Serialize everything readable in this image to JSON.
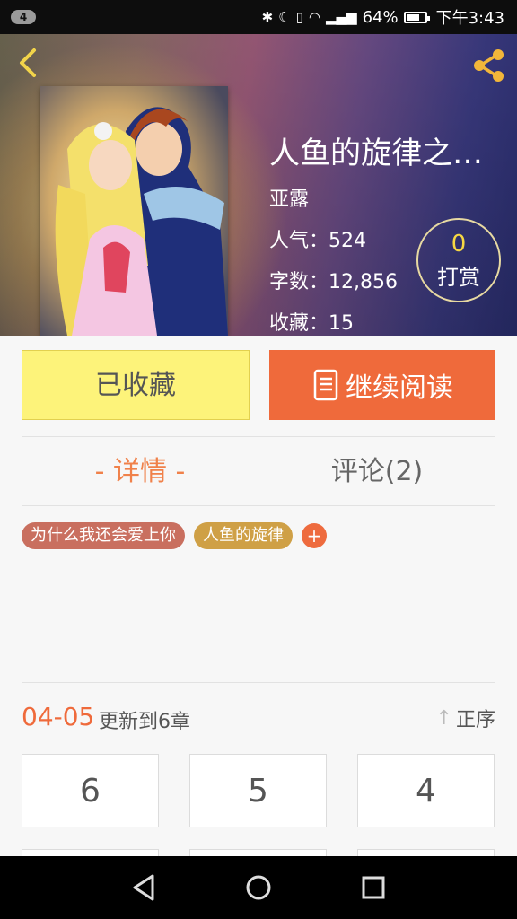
{
  "status_bar": {
    "notification_count": "4",
    "battery": "64%",
    "time": "下午3:43",
    "icons": [
      "bluetooth-icon",
      "moon-icon",
      "vibrate-icon",
      "wifi-icon",
      "signal-icon",
      "battery-icon"
    ]
  },
  "header": {
    "title": "人鱼的旋律之…",
    "author": "亚露",
    "popularity_label": "人气：",
    "popularity": "524",
    "word_count_label": "字数：",
    "word_count": "12,856",
    "favorites_label": "收藏：",
    "favorites": "15",
    "reward_count": "0",
    "reward_label": "打赏"
  },
  "actions": {
    "collected_label": "已收藏",
    "continue_label": "继续阅读"
  },
  "tabs": {
    "detail": "- 详情 -",
    "comments": "评论(2)"
  },
  "tags": [
    "为什么我还会爱上你",
    "人鱼的旋律",
    "+"
  ],
  "updates": {
    "date": "04-05",
    "text": "更新到6章",
    "sort_label": "正序"
  },
  "chapters": [
    "6",
    "5",
    "4"
  ],
  "colors": {
    "accent": "#ef6a3b",
    "collected_bg": "#fdf37a",
    "tag_1": "#c96f5f",
    "tag_2": "#cfa046"
  }
}
